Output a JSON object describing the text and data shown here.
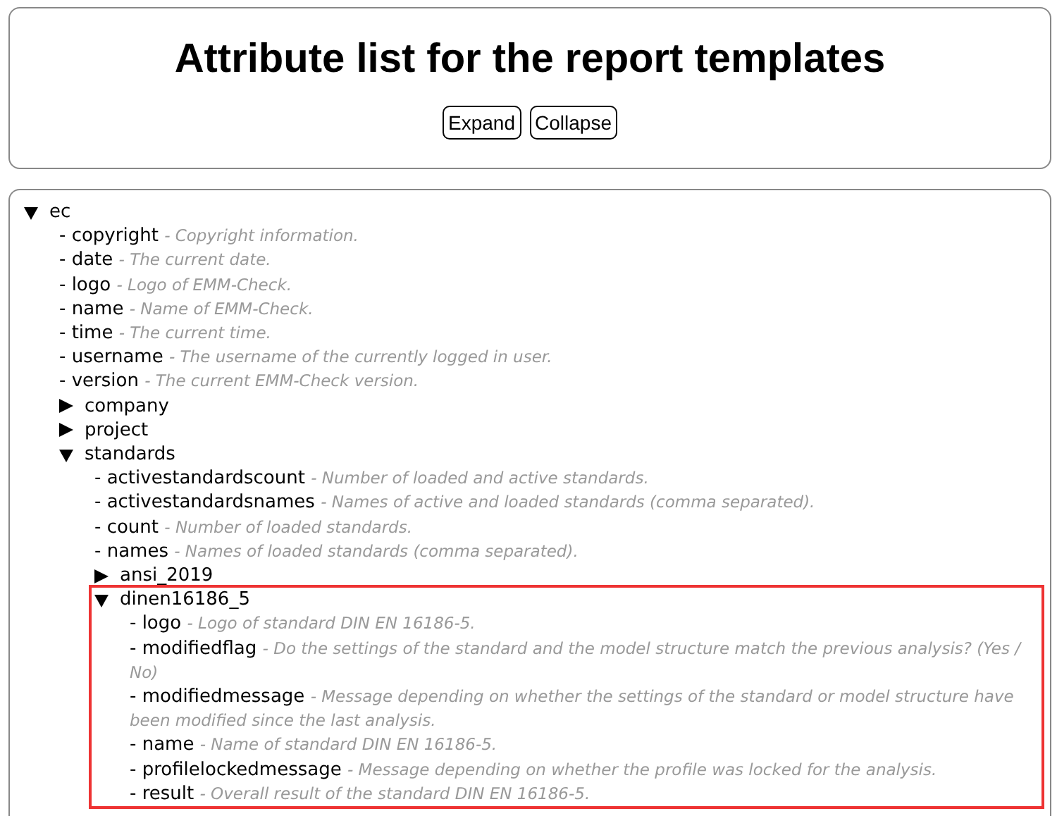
{
  "header": {
    "title": "Attribute list for the report templates",
    "buttons": [
      "Expand",
      "Collapse"
    ]
  },
  "tree": [
    {
      "kind": "branch",
      "name": "ec",
      "expanded": true,
      "highlighted": false,
      "children": [
        {
          "kind": "leaf",
          "name": "- copyright",
          "description": "- Copyright information."
        },
        {
          "kind": "leaf",
          "name": "- date",
          "description": "- The current date."
        },
        {
          "kind": "leaf",
          "name": "- logo",
          "description": "- Logo of EMM-Check."
        },
        {
          "kind": "leaf",
          "name": "- name",
          "description": "- Name of EMM-Check."
        },
        {
          "kind": "leaf",
          "name": "- time",
          "description": "- The current time."
        },
        {
          "kind": "leaf",
          "name": "- username",
          "description": "- The username of the currently logged in user."
        },
        {
          "kind": "leaf",
          "name": "- version",
          "description": "- The current EMM-Check version."
        },
        {
          "kind": "branch",
          "name": "company",
          "expanded": false,
          "highlighted": false
        },
        {
          "kind": "branch",
          "name": "project",
          "expanded": false,
          "highlighted": false
        },
        {
          "kind": "branch",
          "name": "standards",
          "expanded": true,
          "highlighted": false,
          "children": [
            {
              "kind": "leaf",
              "name": "- activestandardscount",
              "description": "- Number of loaded and active standards."
            },
            {
              "kind": "leaf",
              "name": "- activestandardsnames",
              "description": "- Names of active and loaded standards (comma separated)."
            },
            {
              "kind": "leaf",
              "name": "- count",
              "description": "- Number of loaded standards."
            },
            {
              "kind": "leaf",
              "name": "- names",
              "description": "- Names of loaded standards (comma separated)."
            },
            {
              "kind": "branch",
              "name": "ansi_2019",
              "expanded": false,
              "highlighted": false
            },
            {
              "kind": "branch",
              "name": "dinen16186_5",
              "expanded": true,
              "highlighted": true,
              "children": [
                {
                  "kind": "leaf",
                  "name": "- logo",
                  "description": "- Logo of standard DIN EN 16186-5."
                },
                {
                  "kind": "leaf",
                  "name": "- modifiedflag",
                  "description": "- Do the settings of the standard and the model structure match the previous analysis? (Yes / No)"
                },
                {
                  "kind": "leaf",
                  "name": "- modifiedmessage",
                  "description": "- Message depending on whether the settings of the standard or model structure have been modified since the last analysis."
                },
                {
                  "kind": "leaf",
                  "name": "- name",
                  "description": "- Name of standard DIN EN 16186-5."
                },
                {
                  "kind": "leaf",
                  "name": "- profilelockedmessage",
                  "description": "- Message depending on whether the profile was locked for the analysis."
                },
                {
                  "kind": "leaf",
                  "name": "- result",
                  "description": "- Overall result of the standard DIN EN 16186-5."
                }
              ]
            }
          ]
        }
      ]
    }
  ]
}
